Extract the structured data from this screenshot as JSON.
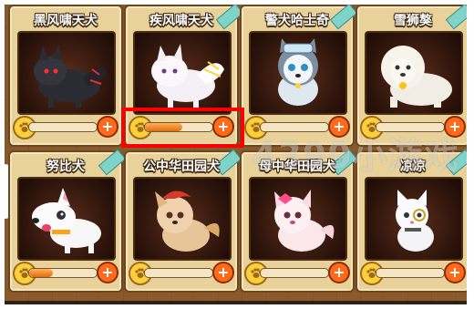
{
  "pets": [
    {
      "name": "黑风啸天犬",
      "progress": 0,
      "icon": "black-wolf-dog"
    },
    {
      "name": "疾风啸天犬",
      "progress": 0.55,
      "icon": "white-wolf-dog"
    },
    {
      "name": "警犬哈士奇",
      "progress": 0,
      "icon": "husky-dog"
    },
    {
      "name": "雪狮獒",
      "progress": 0,
      "icon": "snow-lion-mastiff"
    },
    {
      "name": "努比犬",
      "progress": 0.35,
      "icon": "bull-terrier-dog"
    },
    {
      "name": "公中华田园犬",
      "progress": 0,
      "icon": "male-chinese-dog"
    },
    {
      "name": "母中华田园犬",
      "progress": 0,
      "icon": "female-chinese-dog"
    },
    {
      "name": "凉凉",
      "progress": 0,
      "icon": "white-cat"
    }
  ],
  "watermark": "4399小游戏",
  "colors": {
    "accent": "#ff6a1a",
    "highlight": "#ff0000",
    "card": "#e9d29a",
    "frame": "#8b5a2b"
  }
}
